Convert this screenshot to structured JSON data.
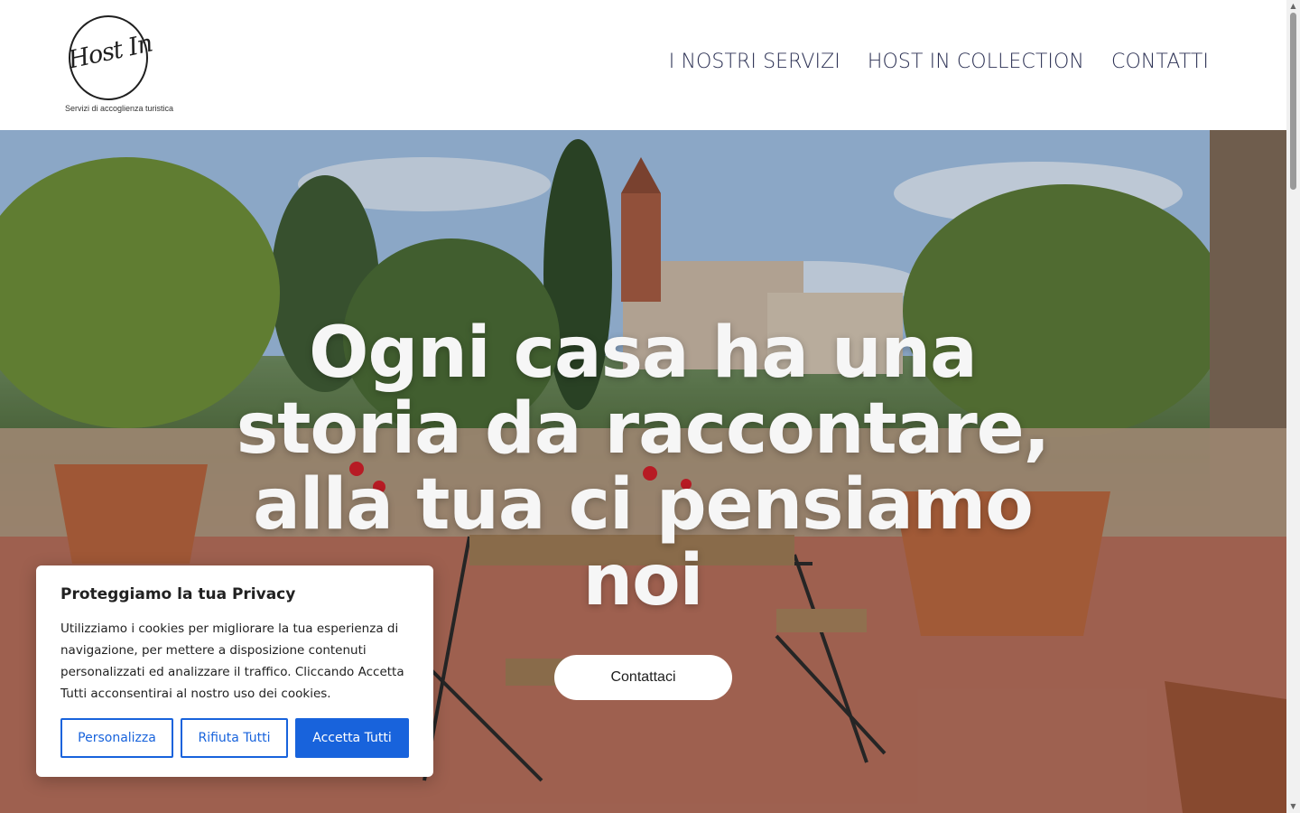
{
  "header": {
    "logo": {
      "script_text": "Host In",
      "tagline": "Servizi di accoglienza turistica"
    },
    "nav": [
      {
        "label": "I NOSTRI SERVIZI"
      },
      {
        "label": "HOST IN COLLECTION"
      },
      {
        "label": "CONTATTI"
      }
    ]
  },
  "hero": {
    "title": "Ogni casa ha una storia da raccontare, alla tua ci pensiamo noi",
    "cta_label": "Contattaci"
  },
  "cookie_banner": {
    "title": "Proteggiamo la tua Privacy",
    "body": "Utilizziamo i cookies per migliorare la tua esperienza di navigazione, per mettere a disposizione contenuti personalizzati ed analizzare il traffico. Cliccando Accetta Tutti acconsentirai al nostro uso dei cookies.",
    "buttons": {
      "customize": "Personalizza",
      "reject": "Rifiuta Tutti",
      "accept": "Accetta Tutti"
    }
  },
  "colors": {
    "nav_text": "#2c3154",
    "cookie_accent": "#1863dc",
    "hero_text": "#f6f6f6"
  },
  "icons": {
    "scroll_up": "triangle-up-icon",
    "scroll_down": "triangle-down-icon"
  }
}
